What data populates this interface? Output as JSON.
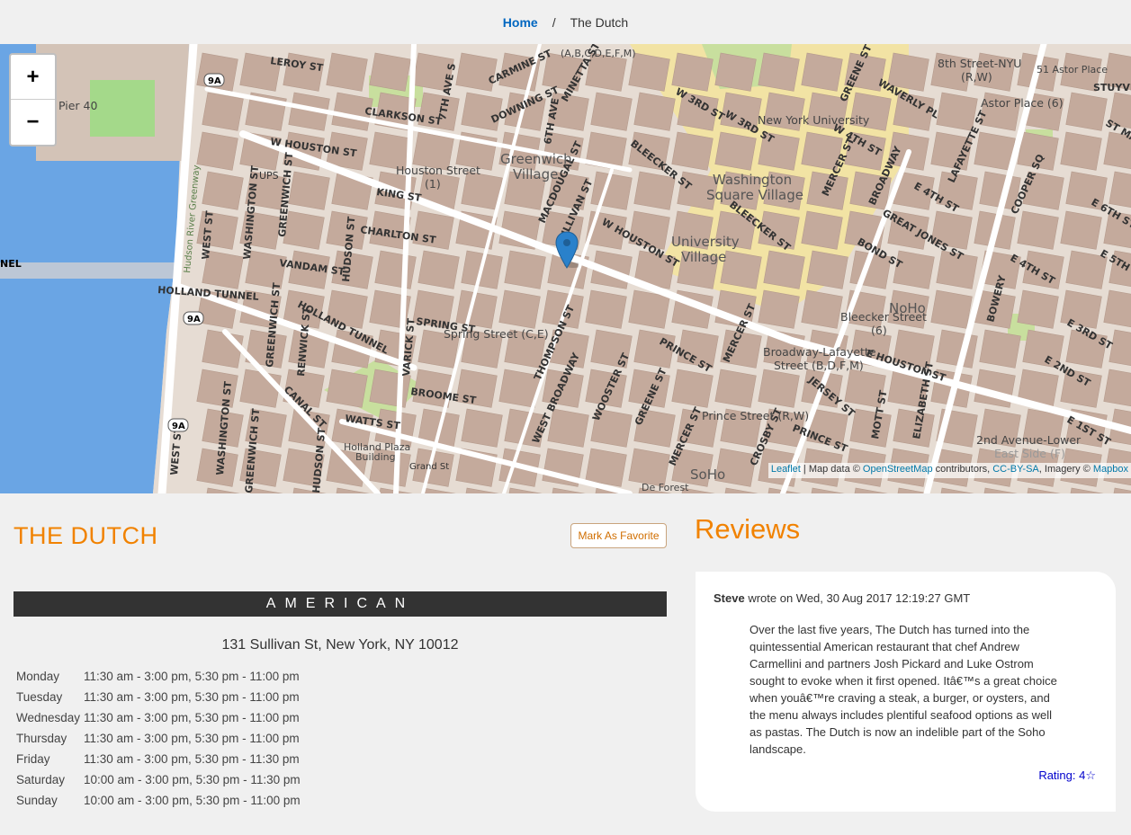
{
  "breadcrumb": {
    "home_label": "Home",
    "separator": "/",
    "current_label": "The Dutch"
  },
  "map": {
    "zoom_in_label": "+",
    "zoom_out_label": "−",
    "attribution": {
      "leaflet": "Leaflet",
      "sep": " | Map data © ",
      "osm": "OpenStreetMap",
      "contributors": " contributors, ",
      "ccbysa": "CC-BY-SA",
      "imagery": ", Imagery © ",
      "mapbox": "Mapbox"
    },
    "labels": {
      "leroy": "LEROY ST",
      "clarkson": "CLARKSON ST",
      "w_houston": "W HOUSTON ST",
      "king": "KING ST",
      "charlton": "CHARLTON ST",
      "vandam": "VANDAM ST",
      "holland_tunnel": "HOLLAND TUNNEL",
      "holland_tunnel_2": "HOLLAND TUNNEL",
      "spring": "SPRING ST",
      "broome": "BROOME ST",
      "watts": "WATTS ST",
      "canal": "CANAL ST",
      "pier40": "Pier 40",
      "houston_station": "Houston Street",
      "houston_station_line": "(1)",
      "spring_station": "Spring Street (C,E)",
      "greenwich_village": "Greenwich",
      "greenwich_village_2": "Village",
      "wash_sq_village": "Washington",
      "wash_sq_village_2": "Square Village",
      "univ_village": "University",
      "univ_village_2": "Village",
      "nyu": "New York University",
      "noho": "NoHo",
      "soho": "SoHo",
      "bleecker_station": "Bleecker Street",
      "bleecker_station_line": "(6)",
      "bway_laf": "Broadway-Lafayette",
      "bway_laf_line": "Street (B,D,F,M)",
      "prince_station": "Prince Street (R,W)",
      "second_ave": "2nd Avenue-Lower",
      "east_side": "East Side (F)",
      "eighth_st": "8th Street-NYU",
      "eighth_st_line": "(R,W)",
      "astor_51": "51 Astor Place",
      "astor_place": "Astor Place (6)",
      "carmine": "CARMINE ST",
      "downing": "DOWNING ST",
      "minetta": "MINETTA ST",
      "bleecker": "BLEECKER ST",
      "bleecker_2": "BLEECKER ST",
      "macdougal": "MACDOUGAL ST",
      "sullivan": "SULLIVAN ST",
      "w_houston_2": "W HOUSTON ST",
      "thompson": "THOMPSON ST",
      "west_broadway": "WEST BROADWAY",
      "wooster": "WOOSTER ST",
      "greene": "GREENE ST",
      "greene_2": "GREENE ST",
      "mercer": "MERCER ST",
      "mercer_2": "MERCER ST",
      "mercer_3": "MERCER ST",
      "broadway": "BROADWAY",
      "prince": "PRINCE ST",
      "prince_2": "PRINCE ST",
      "jersey": "JERSEY ST",
      "crosby": "CROSBY ST",
      "mott": "MOTT ST",
      "elizabeth": "ELIZABETH ST",
      "e_houston": "E HOUSTON ST",
      "bond": "BOND ST",
      "great_jones": "GREAT JONES ST",
      "e4th": "E 4TH ST",
      "e4th_2": "E 4TH ST",
      "w4th": "W 4TH ST",
      "w3rd": "W 3RD ST",
      "w3rd_2": "W 3RD ST",
      "lafayette": "LAFAYETTE ST",
      "bowery": "BOWERY",
      "cooper": "COOPER SQ",
      "waverly": "WAVERLY PL",
      "e3rd": "E 3RD ST",
      "e2nd": "E 2ND ST",
      "e1st": "E 1ST ST",
      "e5th": "E 5TH ST",
      "e6th": "E 6TH ST",
      "stuyve": "STUYVE",
      "st_ma": "ST MA",
      "washington_st": "WASHINGTON ST",
      "washington_st_2": "WASHINGTON ST",
      "greenwich_st": "GREENWICH ST",
      "greenwich_st_2": "GREENWICH ST",
      "greenwich_st_3": "GREENWICH ST",
      "hudson_st": "HUDSON ST",
      "hudson_st_2": "HUDSON ST",
      "varick": "VARICK ST",
      "renwick": "RENWICK ST",
      "west_st": "WEST ST",
      "west_st_2": "WEST ST",
      "sixth_ave": "6TH AVE",
      "seventh_ave": "7TH AVE S",
      "grand": "Grand St",
      "holland_plaza": "Holland Plaza",
      "holland_plaza_2": "Building",
      "ups": "UPS",
      "hudson_greenway": "Hudson River Greenway",
      "de_forest": "De Forest",
      "abcdefm": "(A,B,C,D,E,F,M)",
      "route_9a": "9A",
      "nel": "NEL"
    }
  },
  "restaurant": {
    "name": "THE DUTCH",
    "favorite_button": "Mark As Favorite",
    "cuisine": "AMERICAN",
    "address": "131 Sullivan St, New York, NY 10012",
    "hours": [
      {
        "day": "Monday",
        "time": "11:30 am - 3:00 pm, 5:30 pm - 11:00 pm"
      },
      {
        "day": "Tuesday",
        "time": "11:30 am - 3:00 pm, 5:30 pm - 11:00 pm"
      },
      {
        "day": "Wednesday",
        "time": "11:30 am - 3:00 pm, 5:30 pm - 11:00 pm"
      },
      {
        "day": "Thursday",
        "time": "11:30 am - 3:00 pm, 5:30 pm - 11:00 pm"
      },
      {
        "day": "Friday",
        "time": "11:30 am - 3:00 pm, 5:30 pm - 11:30 pm"
      },
      {
        "day": "Saturday",
        "time": "10:00 am - 3:00 pm, 5:30 pm - 11:30 pm"
      },
      {
        "day": "Sunday",
        "time": "10:00 am - 3:00 pm, 5:30 pm - 11:00 pm"
      }
    ]
  },
  "reviews": {
    "title": "Reviews",
    "items": [
      {
        "author": "Steve",
        "wrote_on": " wrote on Wed, 30 Aug 2017 12:19:27 GMT",
        "text": "Over the last five years, The Dutch has turned into the quintessential American restaurant that chef Andrew Carmellini and partners Josh Pickard and Luke Ostrom sought to evoke when it first opened. Itâ€™s a great choice when youâ€™re craving a steak, a burger, or oysters, and the menu always includes plentiful seafood options as well as pastas. The Dutch is now an indelible part of the Soho landscape.",
        "rating": "Rating: 4☆"
      }
    ]
  },
  "colors": {
    "accent": "#f18200",
    "link": "#0066c0",
    "water": "#6aa5e4",
    "park": "#c8df9e",
    "campus": "#f2e3a4",
    "block": "#c4aa9c",
    "street": "#ffffff",
    "marker": "#2a81cb"
  }
}
